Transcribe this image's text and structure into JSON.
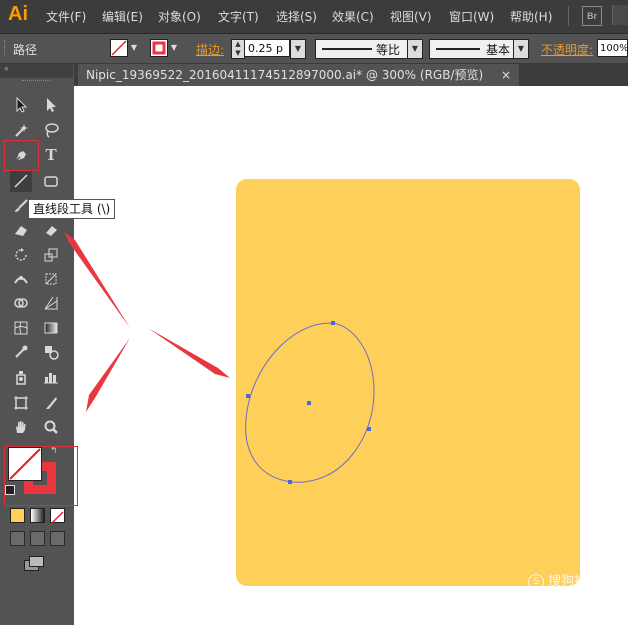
{
  "app": {
    "logo": "Ai",
    "brand_color": "#ff9a00"
  },
  "menu": [
    "文件(F)",
    "编辑(E)",
    "对象(O)",
    "文字(T)",
    "选择(S)",
    "效果(C)",
    "视图(V)",
    "窗口(W)",
    "帮助(H)"
  ],
  "bridge_label": "Br",
  "control": {
    "path_label": "路径",
    "stroke_label": "描边:",
    "stroke_value": "0.25 p",
    "profile_label": "等比",
    "brush_label": "基本",
    "opacity_label": "不透明度:",
    "opacity_value": "100%"
  },
  "document": {
    "tab_title": "Nipic_19369522_20160411174512897000.ai* @ 300% (RGB/预览)",
    "close": "×"
  },
  "tooltip": "直线段工具 (\\)",
  "shape": {
    "fill": "#fed05a",
    "path_color": "#6b6bd3"
  },
  "annotations": {
    "color": "#e8373f"
  },
  "watermark": "搜狗指南"
}
